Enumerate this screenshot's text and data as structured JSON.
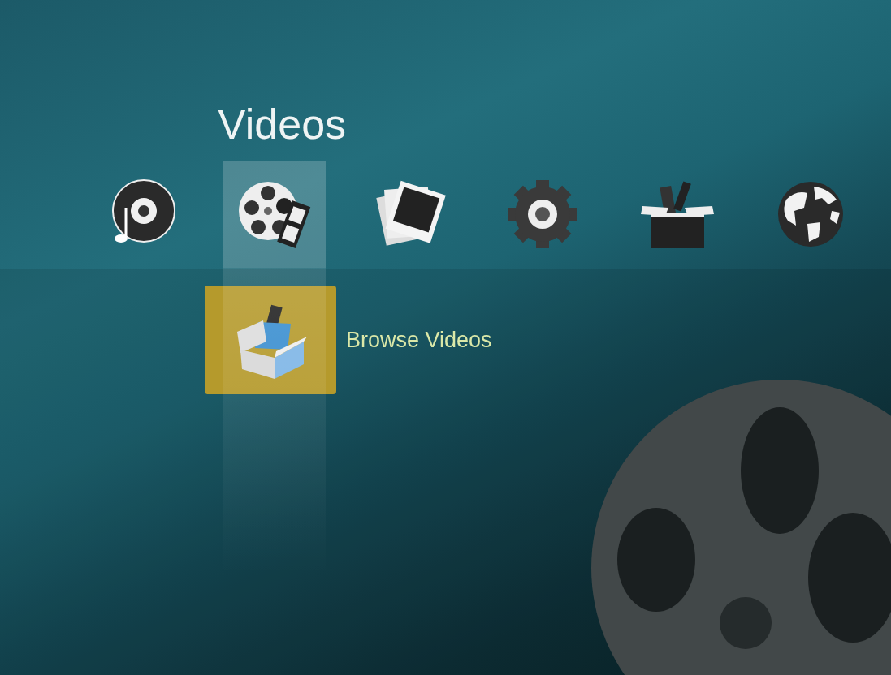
{
  "title": "Videos",
  "categories": [
    {
      "kind": "music",
      "selected": false
    },
    {
      "kind": "videos",
      "selected": true
    },
    {
      "kind": "photos",
      "selected": false
    },
    {
      "kind": "settings",
      "selected": false
    },
    {
      "kind": "programs",
      "selected": false
    },
    {
      "kind": "web",
      "selected": false
    }
  ],
  "submenu": [
    {
      "label": "Browse Videos",
      "selected": true
    }
  ]
}
